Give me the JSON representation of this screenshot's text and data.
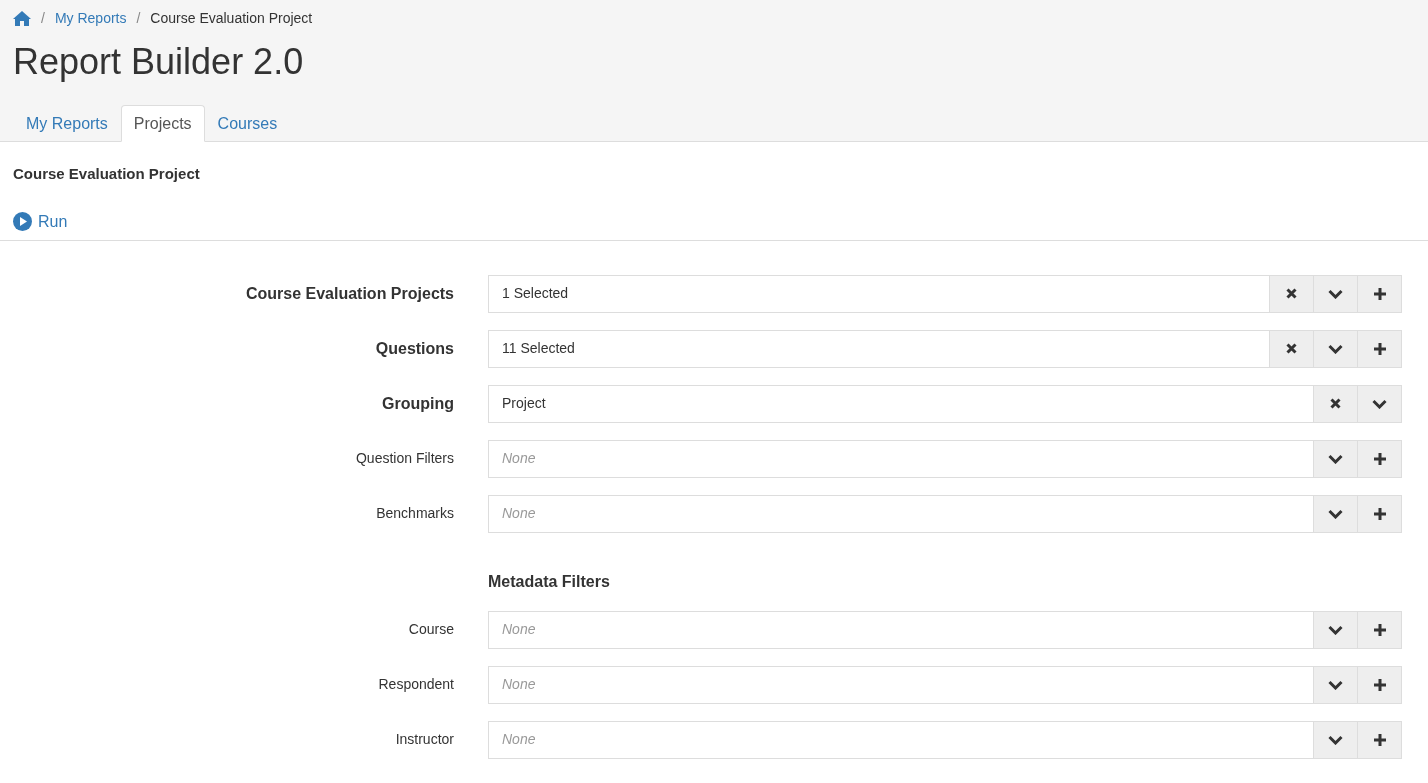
{
  "breadcrumb": [
    {
      "separator": "/",
      "label": "My Reports",
      "link": true
    },
    {
      "separator": "/",
      "label": "Course Evaluation Project",
      "link": false
    }
  ],
  "title": "Report Builder 2.0",
  "tabs": [
    {
      "label": "My Reports",
      "selected": false
    },
    {
      "label": "Projects",
      "selected": true
    },
    {
      "label": "Courses",
      "selected": false
    }
  ],
  "project_title": "Course Evaluation Project",
  "run_button": "Run",
  "fields": [
    {
      "label": "Course Evaluation Projects",
      "kind": "required",
      "value": "1 Selected",
      "clear": true,
      "dropdown": true,
      "add": true
    },
    {
      "label": "Questions",
      "kind": "required",
      "value": "11 Selected",
      "clear": true,
      "dropdown": true,
      "add": true
    },
    {
      "label": "Grouping",
      "kind": "required",
      "value": "Project",
      "clear": true,
      "dropdown": true,
      "add": false
    },
    {
      "label": "Question Filters",
      "kind": "optional",
      "placeholder": "None",
      "clear": false,
      "dropdown": true,
      "add": true
    },
    {
      "label": "Benchmarks",
      "kind": "optional",
      "placeholder": "None",
      "clear": false,
      "dropdown": true,
      "add": true
    }
  ],
  "metadata_filters": {
    "heading": "Metadata Filters",
    "fields": [
      {
        "label": "Course",
        "kind": "optional",
        "placeholder": "None",
        "clear": false,
        "dropdown": true,
        "add": true
      },
      {
        "label": "Respondent",
        "kind": "optional",
        "placeholder": "None",
        "clear": false,
        "dropdown": true,
        "add": true
      },
      {
        "label": "Instructor",
        "kind": "optional",
        "placeholder": "None",
        "clear": false,
        "dropdown": true,
        "add": true
      }
    ]
  }
}
